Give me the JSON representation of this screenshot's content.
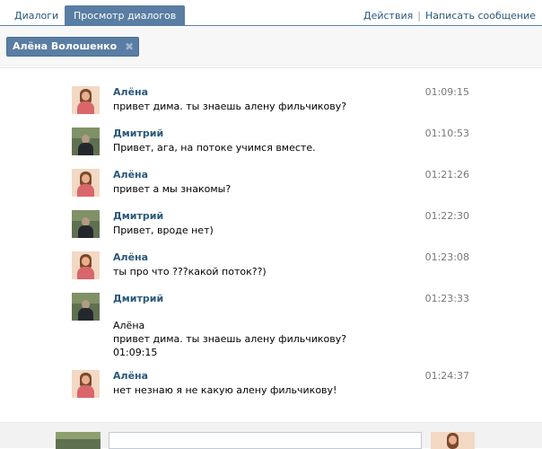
{
  "tabs": [
    {
      "label": "Диалоги",
      "active": false
    },
    {
      "label": "Просмотр диалогов",
      "active": true
    }
  ],
  "actions": {
    "actions_label": "Действия",
    "separator": "|",
    "write_label": "Написать сообщение"
  },
  "filter": {
    "name": "Алёна Волошенко",
    "remove_glyph": "✖"
  },
  "messages": [
    {
      "author": "Алёна",
      "avatar": "alena-avatar",
      "text": "привет дима. ты знаешь алену фильчикову?",
      "time": "01:09:15"
    },
    {
      "author": "Дмитрий",
      "avatar": "dmitry-avatar",
      "text": "Привет, ага, на потоке учимся вместе.",
      "time": "01:10:53"
    },
    {
      "author": "Алёна",
      "avatar": "alena-avatar",
      "text": "привет а мы знакомы?",
      "time": "01:21:26"
    },
    {
      "author": "Дмитрий",
      "avatar": "dmitry-avatar",
      "text": "Привет, вроде нет)",
      "time": "01:22:30"
    },
    {
      "author": "Алёна",
      "avatar": "alena-avatar",
      "text": "ты про что ???какой поток??)",
      "time": "01:23:08"
    },
    {
      "author": "Дмитрий",
      "avatar": "dmitry-avatar",
      "time": "01:23:33",
      "forwarded": {
        "author": "Алёна",
        "text": "привет дима. ты знаешь алену фильчикову?",
        "time": "01:09:15"
      }
    },
    {
      "author": "Алёна",
      "avatar": "alena-avatar",
      "text": "нет незнаю я не какую алену фильчикову!",
      "time": "01:24:37"
    }
  ],
  "compose": {
    "value": ""
  },
  "colors": {
    "accent": "#597da3",
    "link": "#2b587a",
    "time": "#777777"
  }
}
